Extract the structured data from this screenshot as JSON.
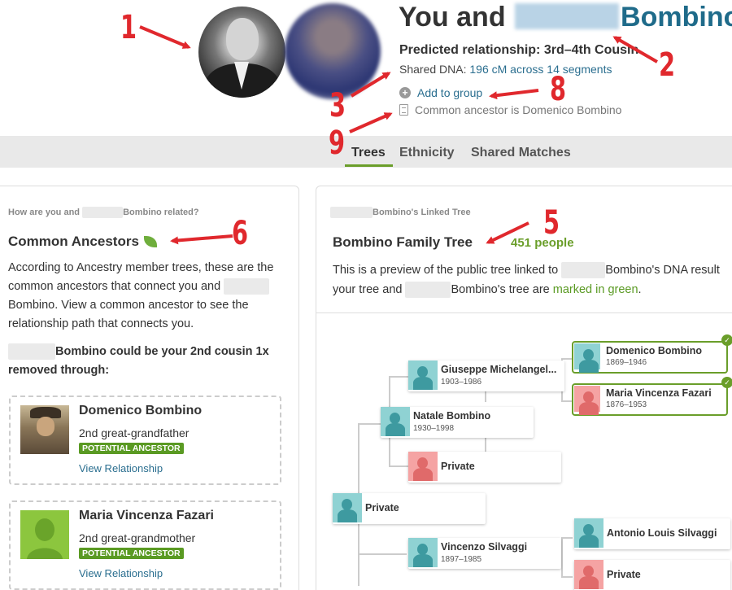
{
  "header": {
    "title_prefix": "You and",
    "title_surname": "Bombino",
    "predicted_relationship": "Predicted relationship: 3rd–4th Cousin",
    "shared_dna_label": "Shared DNA:",
    "shared_dna_value": "196 cM across 14 segments",
    "add_to_group": "Add to group",
    "common_ancestor": "Common ancestor is Domenico Bombino"
  },
  "tabs": [
    {
      "label": "Trees",
      "active": true
    },
    {
      "label": "Ethnicity",
      "active": false
    },
    {
      "label": "Shared Matches",
      "active": false
    }
  ],
  "left_panel": {
    "question_prefix": "How are you and",
    "question_suffix": "Bombino related?",
    "heading": "Common Ancestors",
    "description_line1": "According to Ancestry member trees, these are the",
    "description_line2_prefix": "common ancestors that connect you and",
    "description_line3": "Bombino. View a common ancestor to see the",
    "description_line4": "relationship path that connects you.",
    "cousin_line1_suffix": "Bombino could be your 2nd cousin 1x",
    "cousin_line2": "removed through:",
    "ancestors": [
      {
        "name": "Domenico Bombino",
        "relationship": "2nd great-grandfather",
        "badge": "POTENTIAL ANCESTOR",
        "link": "View Relationship"
      },
      {
        "name": "Maria Vincenza Fazari",
        "relationship": "2nd great-grandmother",
        "badge": "POTENTIAL ANCESTOR",
        "link": "View Relationship"
      }
    ]
  },
  "right_panel": {
    "linked_tree_label": "Bombino's Linked Tree",
    "tree_title": "Bombino Family Tree",
    "people_count": "451 people",
    "desc_line1_prefix": "This is a preview of the public tree linked to",
    "desc_line1_suffix": "Bombino's DNA result",
    "desc_line2_prefix": "your tree and",
    "desc_line2_middle": "Bombino's tree are",
    "desc_line2_green": "marked in green",
    "desc_line2_end": "."
  },
  "tree": {
    "giuseppe": {
      "name": "Giuseppe Michelangel...",
      "dates": "1903–1986"
    },
    "domenico": {
      "name": "Domenico Bombino",
      "dates": "1869–1946"
    },
    "maria": {
      "name": "Maria Vincenza Fazari",
      "dates": "1876–1953"
    },
    "natale": {
      "name": "Natale Bombino",
      "dates": "1930–1998"
    },
    "private_f": {
      "name": "Private"
    },
    "private_root": {
      "name": "Private"
    },
    "vincenzo": {
      "name": "Vincenzo Silvaggi",
      "dates": "1897–1985"
    },
    "antonio": {
      "name": "Antonio Louis Silvaggi"
    },
    "private_f2": {
      "name": "Private"
    }
  },
  "annotations": [
    "1",
    "2",
    "3",
    "5",
    "6",
    "8",
    "9"
  ],
  "colors": {
    "accent_green": "#6a9e2a",
    "link_blue": "#2a6e8f",
    "annotation_red": "#e0282d",
    "male_avatar": "#8fd2d3",
    "female_avatar": "#f5a3a3"
  }
}
